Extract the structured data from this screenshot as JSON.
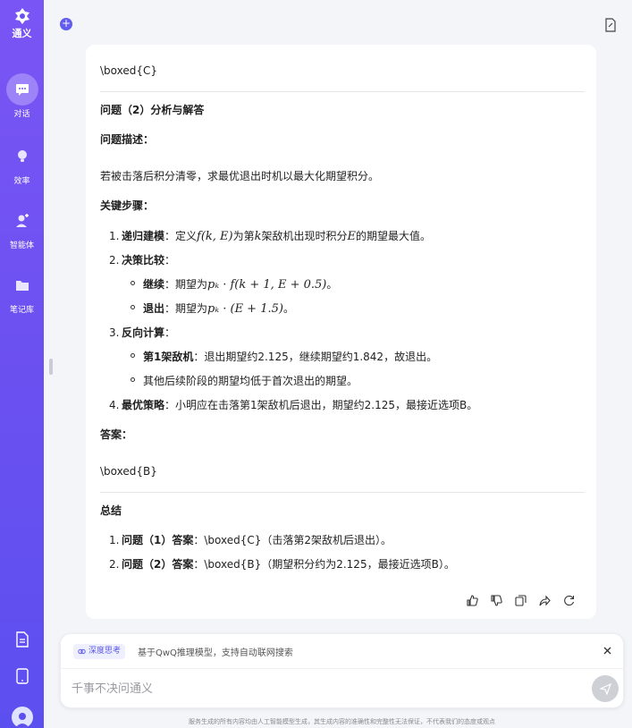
{
  "app": {
    "name": "通义"
  },
  "nav": {
    "items": [
      {
        "label": "对话",
        "icon": "chat-bubble-icon",
        "active": true
      },
      {
        "label": "效率",
        "icon": "lightbulb-icon",
        "active": false
      },
      {
        "label": "智能体",
        "icon": "agent-icon",
        "active": false
      },
      {
        "label": "笔记库",
        "icon": "folder-icon",
        "active": false
      }
    ]
  },
  "message": {
    "boxed_c": "\\boxed{C}",
    "q2_title": "问题（2）分析与解答",
    "problem_label": "问题描述：",
    "problem_text": "若被击落后积分清零，求最优退出时机以最大化期望积分。",
    "steps_label": "关键步骤：",
    "step1": {
      "num": "1.",
      "bold": "递归建模",
      "pre": "：定义",
      "math1": "f(k, E)",
      "mid1": "为第",
      "math2": "k",
      "mid2": "架敌机出现时积分",
      "math3": "E",
      "post": "的期望最大值。"
    },
    "step2": {
      "num": "2.",
      "bold": "决策比较",
      "post": "："
    },
    "step2a": {
      "bold": "继续",
      "pre": "：期望为",
      "math": "pₖ · f(k + 1, E + 0.5)",
      "post": "。"
    },
    "step2b": {
      "bold": "退出",
      "pre": "：期望为",
      "math": "pₖ · (E + 1.5)",
      "post": "。"
    },
    "step3": {
      "num": "3.",
      "bold": "反向计算",
      "post": "："
    },
    "step3a": {
      "bold": "第1架敌机",
      "post": "：退出期望约2.125，继续期望约1.842，故退出。"
    },
    "step3b": {
      "text": "其他后续阶段的期望均低于首次退出的期望。"
    },
    "step4": {
      "num": "4.",
      "bold": "最优策略",
      "post": "：小明应在击落第1架敌机后退出，期望约2.125，最接近选项B。"
    },
    "answer_label": "答案：",
    "boxed_b": "\\boxed{B}",
    "summary_title": "总结",
    "summary1": {
      "num": "1.",
      "bold": "问题（1）答案",
      "post": "：\\boxed{C}（击落第2架敌机后退出）。"
    },
    "summary2": {
      "num": "2.",
      "bold": "问题（2）答案",
      "post": "：\\boxed{B}（期望积分约为2.125，最接近选项B）。"
    }
  },
  "composer": {
    "deep_think_label": "深度思考",
    "deep_think_desc": "基于QwQ推理模型，支持自动联网搜索",
    "placeholder": "千事不决问通义",
    "disclaimer": "服务生成的所有内容均由人工智能模型生成，其生成内容的准确性和完整性无法保证，不代表我们的态度或观点"
  },
  "colors": {
    "sidebar": "#6a50f0",
    "accent": "#615ced",
    "send_disabled": "#cfd0d6"
  }
}
